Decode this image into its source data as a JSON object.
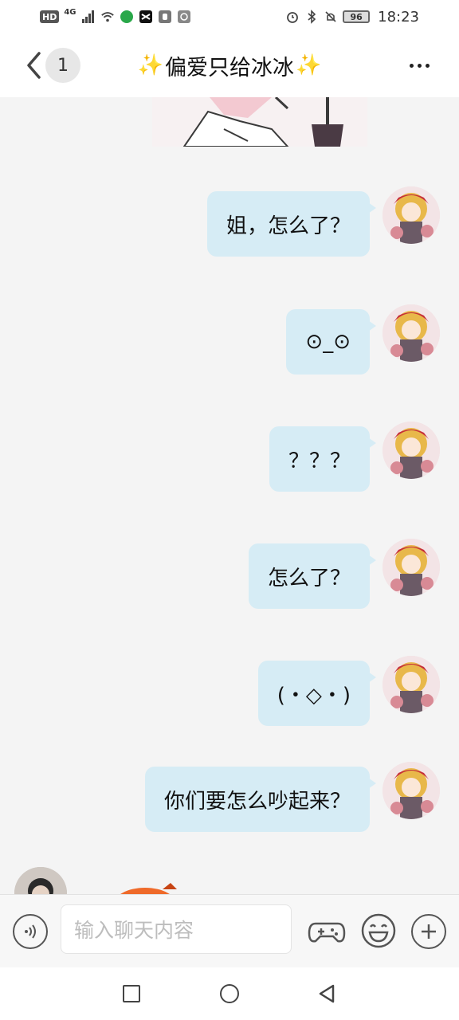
{
  "status_bar": {
    "left_badges": [
      "HD",
      "4G"
    ],
    "battery": "96",
    "time": "18:23"
  },
  "header": {
    "back_badge": "1",
    "title": "偏爱只给冰冰",
    "title_decoration": "sparkles-icon"
  },
  "messages": [
    {
      "side": "right",
      "text": "姐，怎么了？"
    },
    {
      "side": "right",
      "text": "⊙_⊙"
    },
    {
      "side": "right",
      "text": "？？？"
    },
    {
      "side": "right",
      "text": "怎么了？"
    },
    {
      "side": "right",
      "text": "(・◇・)"
    },
    {
      "side": "right",
      "text": "你们要怎么吵起来？"
    }
  ],
  "input_bar": {
    "placeholder": "输入聊天内容"
  },
  "colors": {
    "bubble": "#d6ecf5",
    "chat_bg": "#f4f4f4",
    "sparkle": "#f5c518"
  }
}
